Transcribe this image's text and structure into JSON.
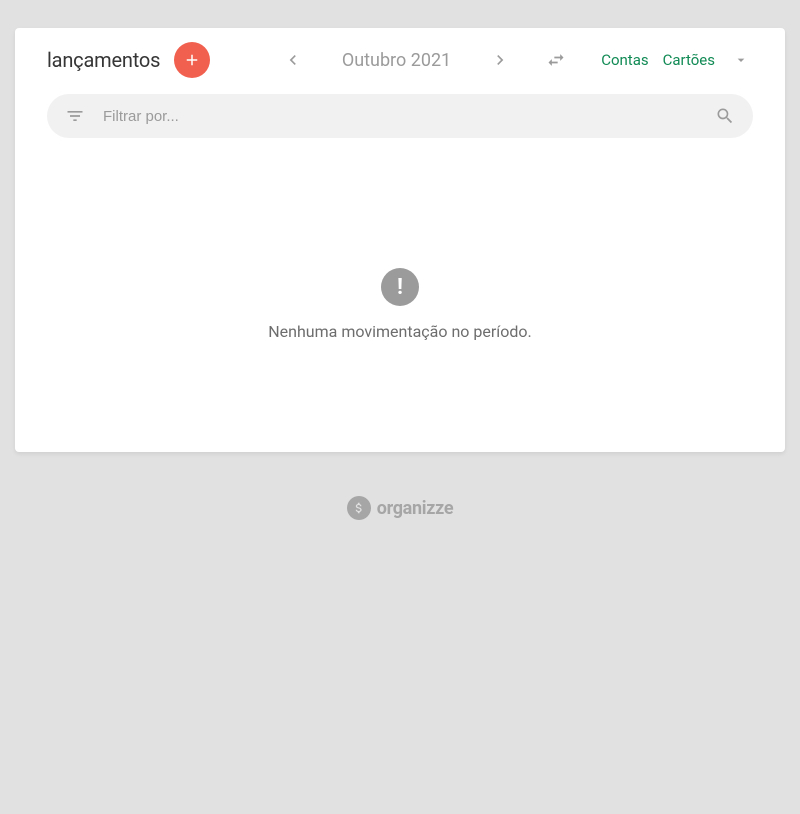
{
  "header": {
    "title": "lançamentos",
    "period": "Outubro 2021"
  },
  "tabs": {
    "accounts": "Contas",
    "cards": "Cartões"
  },
  "filter": {
    "placeholder": "Filtrar por..."
  },
  "empty": {
    "badge": "!",
    "message": "Nenhuma movimentação no período."
  },
  "footer": {
    "brand": "organizze"
  }
}
